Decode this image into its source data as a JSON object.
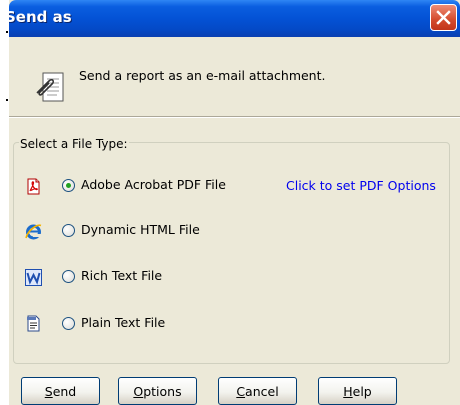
{
  "window": {
    "title": "Send as"
  },
  "header": {
    "icon": "email-attachment-icon",
    "description": "Send a report as an e-mail attachment."
  },
  "file_types": {
    "group_label": "Select a File Type:",
    "selected": "pdf",
    "options": [
      {
        "id": "pdf",
        "label": "Adobe Acrobat PDF File",
        "icon": "pdf-file-icon",
        "checked": true
      },
      {
        "id": "html",
        "label": "Dynamic HTML File",
        "icon": "internet-explorer-icon",
        "checked": false
      },
      {
        "id": "rtf",
        "label": "Rich Text File",
        "icon": "word-document-icon",
        "checked": false
      },
      {
        "id": "txt",
        "label": "Plain Text File",
        "icon": "notepad-icon",
        "checked": false
      }
    ],
    "pdf_options_link": "Click to set PDF Options"
  },
  "buttons": {
    "send": {
      "mnemonic": "S",
      "rest": "end"
    },
    "options": {
      "mnemonic": "O",
      "rest": "ptions"
    },
    "cancel": {
      "mnemonic": "C",
      "rest": "ancel"
    },
    "help": {
      "mnemonic": "H",
      "rest": "elp"
    }
  },
  "colors": {
    "titlebar": "#0452d5",
    "dialog_bg": "#ece9d8",
    "link": "#0000ee",
    "close_button": "#d34a2c"
  }
}
